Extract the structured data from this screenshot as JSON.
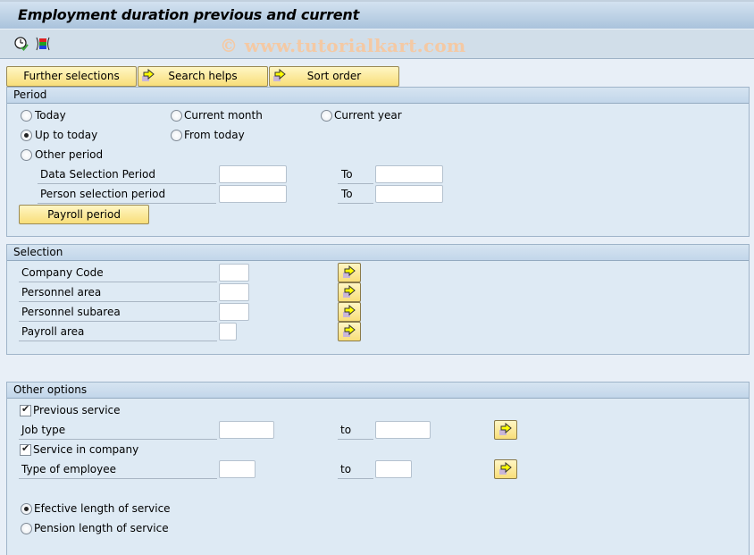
{
  "window": {
    "title": "Employment duration previous and current",
    "watermark": "© www.tutorialkart.com"
  },
  "toolbar": {
    "icons": [
      {
        "name": "execute-clock-icon",
        "tooltip": ""
      },
      {
        "name": "select-variant-icon",
        "tooltip": ""
      }
    ]
  },
  "buttons": {
    "further_selections": "Further selections",
    "search_helps": "Search helps",
    "sort_order": "Sort order",
    "payroll_period": "Payroll period"
  },
  "period": {
    "header": "Period",
    "radios": {
      "today": {
        "label": "Today",
        "selected": false
      },
      "current_month": {
        "label": "Current month",
        "selected": false
      },
      "current_year": {
        "label": "Current year",
        "selected": false
      },
      "up_to_today": {
        "label": "Up to today",
        "selected": true
      },
      "from_today": {
        "label": "From today",
        "selected": false
      },
      "other_period": {
        "label": "Other period",
        "selected": false
      }
    },
    "data_selection": {
      "label": "Data Selection Period",
      "from": "",
      "to_label": "To",
      "to": ""
    },
    "person_selection": {
      "label": "Person selection period",
      "from": "",
      "to_label": "To",
      "to": ""
    }
  },
  "selection": {
    "header": "Selection",
    "fields": [
      {
        "label": "Company Code",
        "value": ""
      },
      {
        "label": "Personnel area",
        "value": ""
      },
      {
        "label": "Personnel subarea",
        "value": ""
      },
      {
        "label": "Payroll area",
        "value": ""
      }
    ]
  },
  "other_options": {
    "header": "Other options",
    "previous_service": {
      "label": "Previous service",
      "checked": true
    },
    "job_type": {
      "label": "Job type",
      "from": "",
      "to_label": "to",
      "to": ""
    },
    "service_in_company": {
      "label": "Service in company",
      "checked": true
    },
    "type_of_employee": {
      "label": "Type of employee",
      "from": "",
      "to_label": "to",
      "to": ""
    },
    "effective_length": {
      "label": "Efective length of service",
      "selected": true
    },
    "pension_length": {
      "label": "Pension length of service",
      "selected": false
    }
  }
}
